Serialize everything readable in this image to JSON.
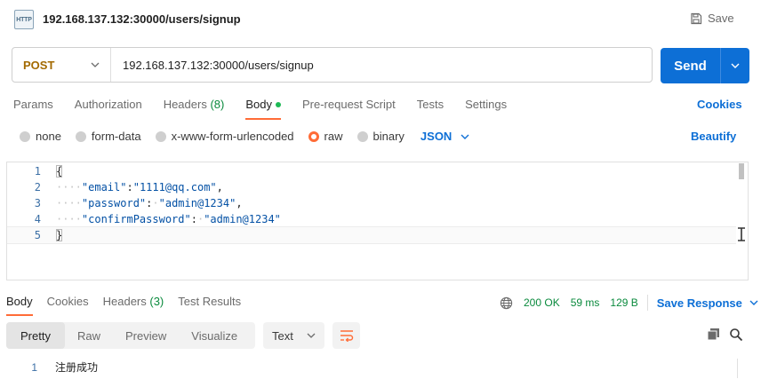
{
  "request": {
    "title": "192.168.137.132:30000/users/signup",
    "icon_text": "HTTP",
    "save_label": "Save",
    "method": "POST",
    "url": "192.168.137.132:30000/users/signup",
    "send_label": "Send"
  },
  "tabs": {
    "params": "Params",
    "authorization": "Authorization",
    "headers": "Headers",
    "headers_count": "(8)",
    "body": "Body",
    "pre_request": "Pre-request Script",
    "tests": "Tests",
    "settings": "Settings",
    "cookies": "Cookies"
  },
  "body_types": {
    "none": "none",
    "form_data": "form-data",
    "urlencoded": "x-www-form-urlencoded",
    "raw": "raw",
    "binary": "binary",
    "selected_format": "JSON",
    "beautify": "Beautify"
  },
  "editor": {
    "lines": [
      {
        "n": "1",
        "text": "{"
      },
      {
        "n": "2",
        "key": "\"email\"",
        "sep": ":",
        "value": "\"1111@qq.com\"",
        "end": ","
      },
      {
        "n": "3",
        "key": "\"password\"",
        "sep": ":",
        "value": "\"admin@1234\"",
        "end": ","
      },
      {
        "n": "4",
        "key": "\"confirmPassword\"",
        "sep": ":",
        "value": "\"admin@1234\"",
        "end": ""
      },
      {
        "n": "5",
        "text": "}"
      }
    ]
  },
  "response": {
    "tabs": {
      "body": "Body",
      "cookies": "Cookies",
      "headers": "Headers",
      "headers_count": "(3)",
      "test_results": "Test Results"
    },
    "status": "200 OK",
    "time": "59 ms",
    "size": "129 B",
    "save_response": "Save Response",
    "view_modes": [
      "Pretty",
      "Raw",
      "Preview",
      "Visualize"
    ],
    "format": "Text",
    "line_number": "1",
    "body_text": "注册成功"
  },
  "colors": {
    "accent_orange": "#ff6c37",
    "brand_blue": "#0d6fd6",
    "status_green": "#0a8a3d",
    "method_color": "#a36a00"
  }
}
